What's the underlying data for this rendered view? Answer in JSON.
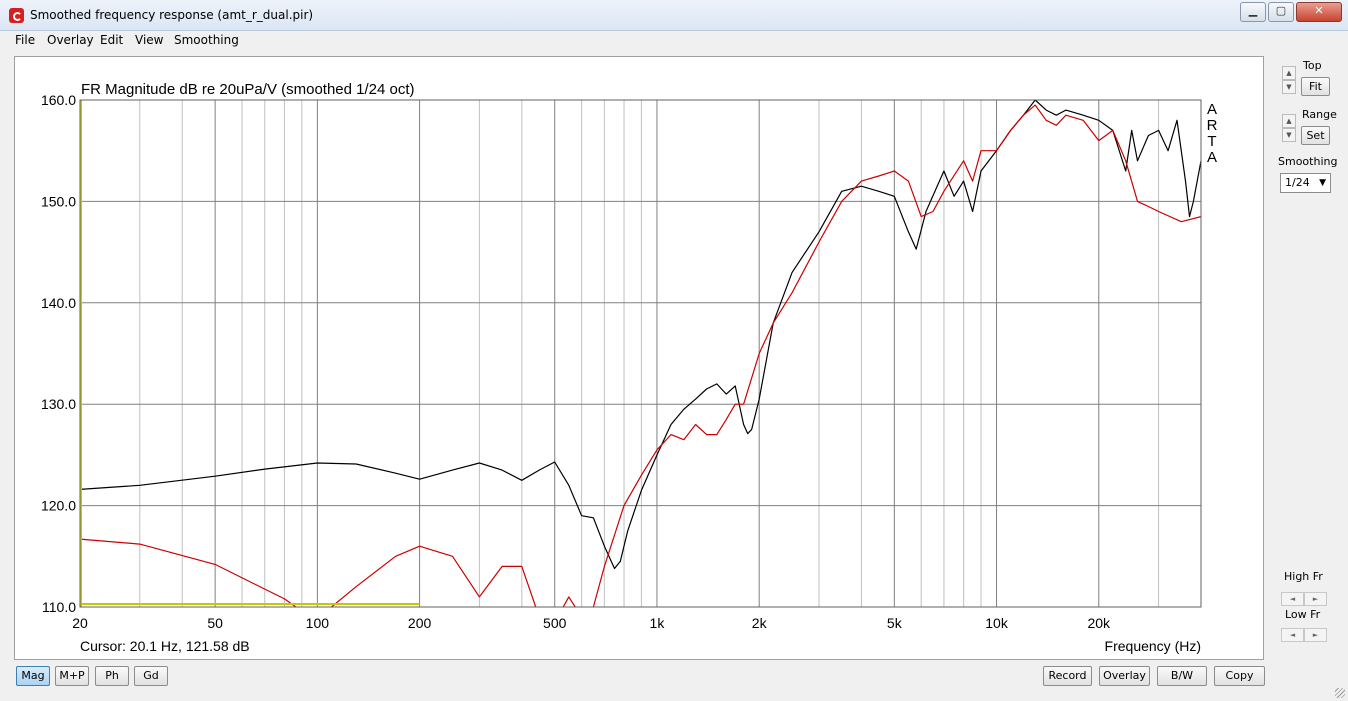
{
  "window": {
    "title": "Smoothed frequency response (amt_r_dual.pir)",
    "minimize": "▁",
    "maximize": "▢",
    "close": "✕"
  },
  "menu": [
    "File",
    "Overlay",
    "Edit",
    "View",
    "Smoothing"
  ],
  "chart": {
    "title": "FR Magnitude dB re 20uPa/V (smoothed 1/24 oct)",
    "xlabel": "Frequency (Hz)",
    "cursor": "Cursor: 20.1 Hz, 121.58 dB",
    "brand": [
      "A",
      "R",
      "T",
      "A"
    ],
    "y_tick_labels": [
      "160.0",
      "150.0",
      "140.0",
      "130.0",
      "120.0",
      "110.0"
    ],
    "x_tick_labels": [
      "20",
      "50",
      "100",
      "200",
      "500",
      "1k",
      "2k",
      "5k",
      "10k",
      "20k"
    ]
  },
  "chart_data": {
    "type": "line",
    "title": "FR Magnitude dB re 20uPa/V (smoothed 1/24 oct)",
    "xlabel": "Frequency (Hz)",
    "ylabel": "",
    "xscale": "log",
    "xlim": [
      20,
      40000
    ],
    "ylim": [
      110,
      160
    ],
    "grid": true,
    "x_ticks": [
      20,
      50,
      100,
      200,
      500,
      1000,
      2000,
      5000,
      10000,
      20000
    ],
    "y_ticks": [
      110,
      120,
      130,
      140,
      150,
      160
    ],
    "series": [
      {
        "color": "#000000",
        "x": [
          20,
          30,
          50,
          70,
          100,
          130,
          170,
          200,
          250,
          300,
          350,
          400,
          450,
          500,
          550,
          600,
          650,
          700,
          750,
          780,
          820,
          900,
          1000,
          1100,
          1200,
          1300,
          1400,
          1500,
          1600,
          1700,
          1800,
          1850,
          1900,
          2000,
          2200,
          2500,
          3000,
          3500,
          4000,
          4500,
          5000,
          5500,
          5800,
          6200,
          7000,
          7500,
          8000,
          8500,
          9000,
          10000,
          11000,
          12000,
          13000,
          14000,
          15000,
          16000,
          18000,
          20000,
          22000,
          24000,
          25000,
          26000,
          28000,
          30000,
          32000,
          34000,
          36000,
          37000,
          38000,
          40000
        ],
        "values": [
          121.6,
          122.0,
          122.9,
          123.6,
          124.2,
          124.1,
          123.2,
          122.6,
          123.5,
          124.2,
          123.5,
          122.5,
          123.5,
          124.3,
          122.0,
          119.0,
          118.8,
          116.0,
          113.8,
          114.5,
          117.5,
          121.5,
          125.0,
          128.0,
          129.5,
          130.5,
          131.5,
          132.0,
          131.0,
          131.8,
          128.0,
          127.1,
          127.5,
          130.5,
          138.0,
          143.0,
          147.0,
          151.0,
          151.5,
          151.0,
          150.5,
          147.0,
          145.3,
          149.0,
          153.0,
          150.5,
          152.0,
          149.0,
          153.0,
          155.0,
          157.0,
          158.5,
          160.0,
          159.0,
          158.5,
          159.0,
          158.5,
          158.0,
          157.0,
          153.0,
          157.0,
          154.0,
          156.5,
          157.0,
          155.0,
          158.0,
          152.0,
          148.5,
          150.0,
          154.0
        ]
      },
      {
        "color": "#cc0000",
        "x": [
          20,
          30,
          50,
          80,
          100,
          110,
          130,
          170,
          200,
          250,
          300,
          350,
          400,
          450,
          500,
          550,
          600,
          650,
          700,
          800,
          900,
          1000,
          1100,
          1200,
          1300,
          1400,
          1500,
          1600,
          1700,
          1800,
          2000,
          2200,
          2500,
          3000,
          3500,
          4000,
          4500,
          5000,
          5500,
          6000,
          6500,
          7000,
          8000,
          8500,
          9000,
          10000,
          11000,
          12000,
          13000,
          14000,
          15000,
          16000,
          18000,
          20000,
          22000,
          24000,
          26000,
          28000,
          30000,
          35000,
          40000
        ],
        "values": [
          116.7,
          116.2,
          114.2,
          110.8,
          108.5,
          110.0,
          112.0,
          115.0,
          116.0,
          115.0,
          111.0,
          114.0,
          114.0,
          109.0,
          108.5,
          111.0,
          109.0,
          110.0,
          114.0,
          120.0,
          123.0,
          125.5,
          127.0,
          126.5,
          128.0,
          127.0,
          127.0,
          128.5,
          130.0,
          130.0,
          135.0,
          138.0,
          141.0,
          146.0,
          150.0,
          152.0,
          152.5,
          153.0,
          152.0,
          148.5,
          149.0,
          151.0,
          154.0,
          152.0,
          155.0,
          155.0,
          157.0,
          158.5,
          159.5,
          158.0,
          157.5,
          158.5,
          158.0,
          156.0,
          157.0,
          154.0,
          150.0,
          149.5,
          149.0,
          148.0,
          148.5
        ]
      },
      {
        "color": "#c8c800",
        "x": [
          20,
          200
        ],
        "values": [
          110.3,
          110.3
        ]
      }
    ]
  },
  "side_panel": {
    "top_label": "Top",
    "fit_label": "Fit",
    "range_label": "Range",
    "set_label": "Set",
    "smoothing_label": "Smoothing",
    "smoothing_value": "1/24",
    "high_fr_label": "High Fr",
    "low_fr_label": "Low Fr"
  },
  "bottom_left": [
    "Mag",
    "M+P",
    "Ph",
    "Gd"
  ],
  "bottom_right": [
    "Record",
    "Overlay",
    "B/W",
    "Copy"
  ]
}
